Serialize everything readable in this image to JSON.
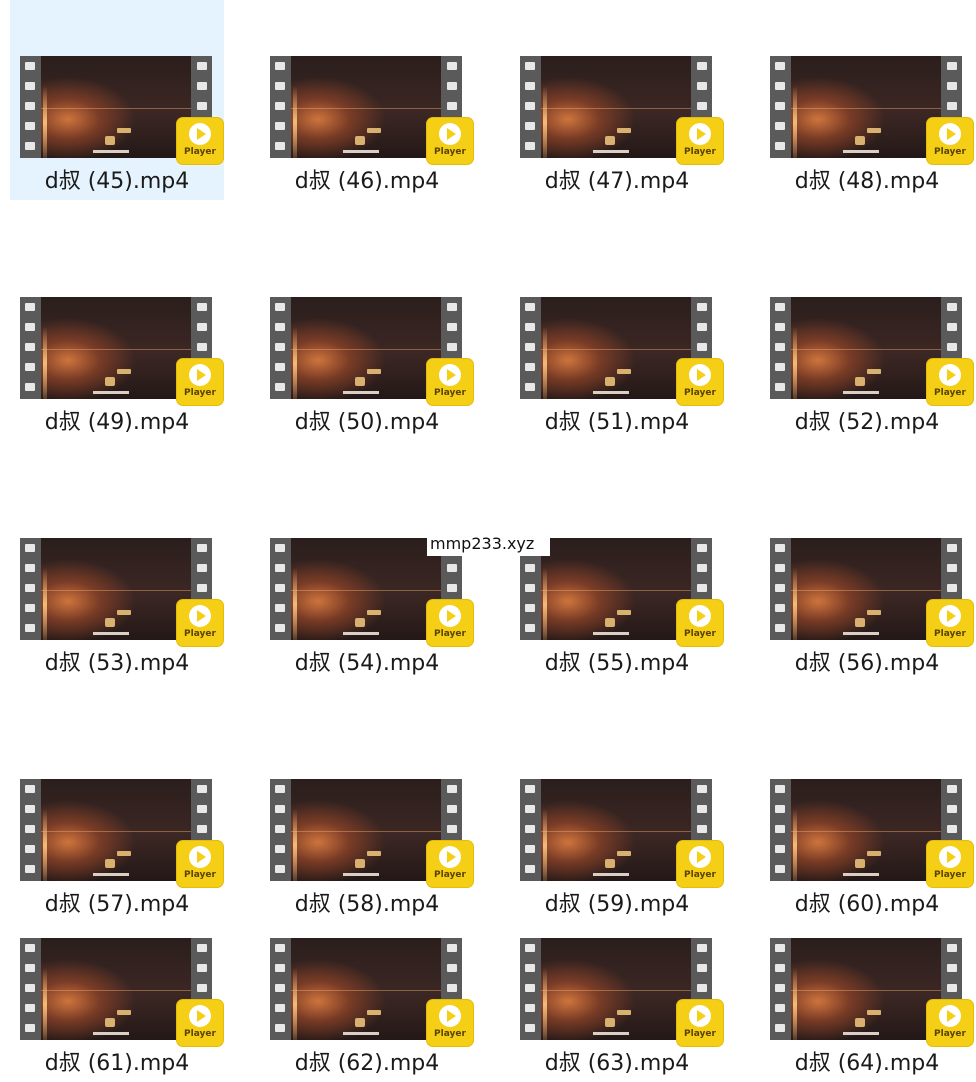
{
  "files": [
    {
      "name": "d叔 (45).mp4",
      "selected": true
    },
    {
      "name": "d叔 (46).mp4",
      "selected": false
    },
    {
      "name": "d叔 (47).mp4",
      "selected": false
    },
    {
      "name": "d叔 (48).mp4",
      "selected": false
    },
    {
      "name": "d叔 (49).mp4",
      "selected": false
    },
    {
      "name": "d叔 (50).mp4",
      "selected": false
    },
    {
      "name": "d叔 (51).mp4",
      "selected": false
    },
    {
      "name": "d叔 (52).mp4",
      "selected": false
    },
    {
      "name": "d叔 (53).mp4",
      "selected": false
    },
    {
      "name": "d叔 (54).mp4",
      "selected": false
    },
    {
      "name": "d叔 (55).mp4",
      "selected": false
    },
    {
      "name": "d叔 (56).mp4",
      "selected": false
    },
    {
      "name": "d叔 (57).mp4",
      "selected": false
    },
    {
      "name": "d叔 (58).mp4",
      "selected": false
    },
    {
      "name": "d叔 (59).mp4",
      "selected": false
    },
    {
      "name": "d叔 (60).mp4",
      "selected": false
    },
    {
      "name": "d叔 (61).mp4",
      "selected": false
    },
    {
      "name": "d叔 (62).mp4",
      "selected": false
    },
    {
      "name": "d叔 (63).mp4",
      "selected": false
    },
    {
      "name": "d叔 (64).mp4",
      "selected": false
    }
  ],
  "player_badge_label": "Player",
  "watermark": "mmp233.xyz",
  "colors": {
    "selection": "#cce8ff",
    "player_badge": "#f5cf15",
    "film_strip": "#5a5a5a"
  },
  "icons": {
    "file_thumbnail": "video-film-strip-icon",
    "player_badge": "player-play-icon"
  }
}
